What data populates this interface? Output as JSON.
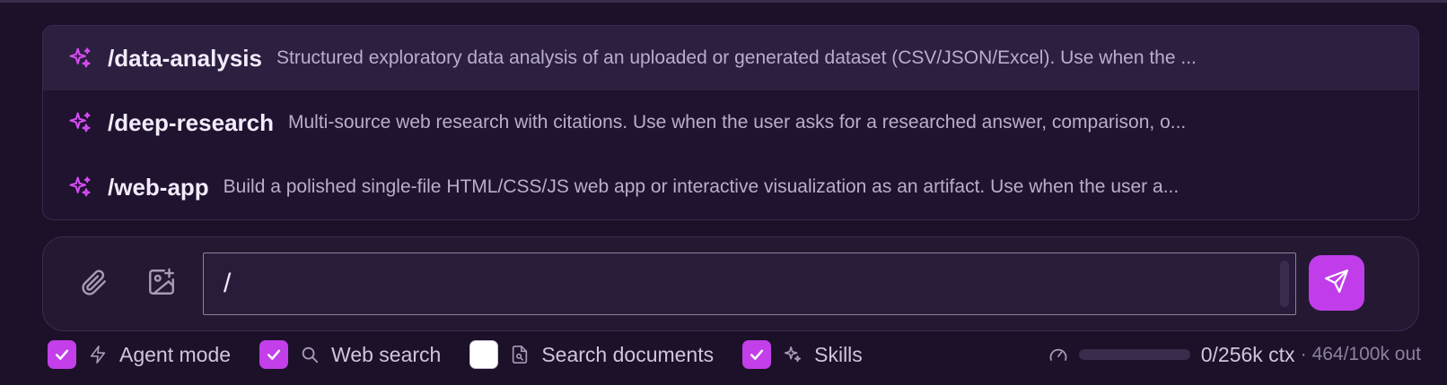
{
  "suggestions": [
    {
      "command": "/data-analysis",
      "description": "Structured exploratory data analysis of an uploaded or generated dataset (CSV/JSON/Excel). Use when the ...",
      "icon": "sparkle-icon",
      "active": true
    },
    {
      "command": "/deep-research",
      "description": "Multi-source web research with citations. Use when the user asks for a researched answer, comparison, o...",
      "icon": "sparkle-icon",
      "active": false
    },
    {
      "command": "/web-app",
      "description": "Build a polished single-file HTML/CSS/JS web app or interactive visualization as an artifact. Use when the user a...",
      "icon": "sparkle-icon",
      "active": false
    }
  ],
  "composer": {
    "input_value": "/",
    "attach_icon": "paperclip-icon",
    "image_icon": "image-plus-icon",
    "send_icon": "send-icon"
  },
  "options": [
    {
      "label": "Agent mode",
      "checked": true,
      "icon": "lightning-icon"
    },
    {
      "label": "Web search",
      "checked": true,
      "icon": "search-icon"
    },
    {
      "label": "Search documents",
      "checked": false,
      "icon": "document-icon"
    },
    {
      "label": "Skills",
      "checked": true,
      "icon": "sparkle-icon"
    }
  ],
  "context": {
    "ctx_text": "0/256k ctx",
    "separator": "·",
    "out_text": "464/100k out",
    "ctx_fraction": 0,
    "icon": "gauge-icon"
  },
  "colors": {
    "accent": "#c03de9",
    "background": "#1c1129"
  }
}
